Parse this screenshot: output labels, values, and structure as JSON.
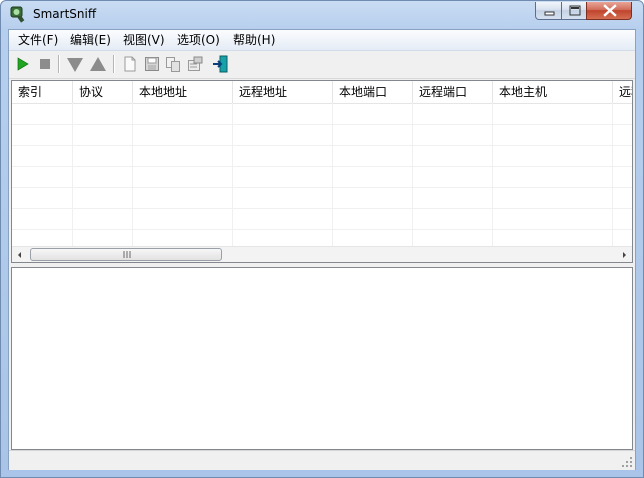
{
  "window": {
    "title": "SmartSniff",
    "app_icon": "smartsniff-app-icon",
    "caption_buttons": [
      "minimize-icon",
      "maximize-icon",
      "close-icon"
    ]
  },
  "menu": {
    "items": [
      {
        "label": "文件(F)"
      },
      {
        "label": "编辑(E)"
      },
      {
        "label": "视图(V)"
      },
      {
        "label": "选项(O)"
      },
      {
        "label": "帮助(H)"
      }
    ]
  },
  "toolbar": {
    "buttons": [
      {
        "icon": "play-icon",
        "color": "#1fa51f",
        "enabled": true
      },
      {
        "icon": "stop-icon",
        "color": "#8c8c8c",
        "enabled": false
      },
      {
        "icon": "arrow-down-icon",
        "color": "#8c8c8c",
        "enabled": false
      },
      {
        "icon": "arrow-up-icon",
        "color": "#8c8c8c",
        "enabled": false
      },
      {
        "icon": "new-document-icon",
        "enabled": false
      },
      {
        "icon": "save-icon",
        "enabled": false
      },
      {
        "icon": "copy-icon",
        "enabled": false
      },
      {
        "icon": "properties-icon",
        "enabled": false
      },
      {
        "icon": "exit-icon",
        "color": "#16a2a8",
        "enabled": true
      }
    ]
  },
  "table": {
    "columns": [
      {
        "label": "索引"
      },
      {
        "label": "协议"
      },
      {
        "label": "本地地址"
      },
      {
        "label": "远程地址"
      },
      {
        "label": "本地端口"
      },
      {
        "label": "远程端口"
      },
      {
        "label": "本地主机"
      },
      {
        "label": "远程"
      }
    ],
    "rows": []
  },
  "lower_pane": {
    "content": ""
  },
  "status_bar": {
    "text": ""
  }
}
